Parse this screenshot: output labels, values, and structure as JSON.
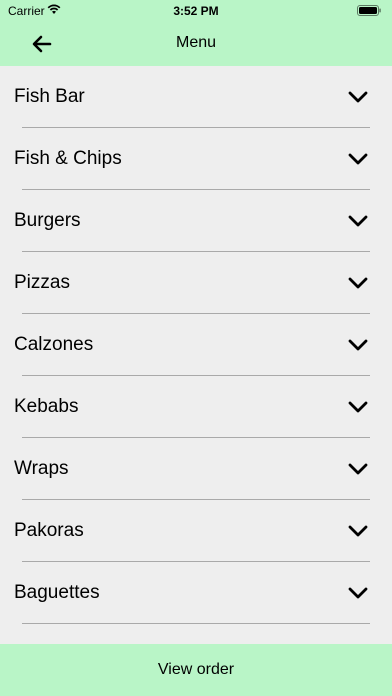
{
  "status_bar": {
    "carrier": "Carrier",
    "time": "3:52 PM",
    "wifi_icon": "wifi-icon",
    "battery_icon": "battery-icon"
  },
  "nav": {
    "title": "Menu",
    "back_icon": "arrow-left-icon"
  },
  "menu": {
    "items": [
      {
        "label": "Fish Bar"
      },
      {
        "label": "Fish & Chips"
      },
      {
        "label": "Burgers"
      },
      {
        "label": "Pizzas"
      },
      {
        "label": "Calzones"
      },
      {
        "label": "Kebabs"
      },
      {
        "label": "Wraps"
      },
      {
        "label": "Pakoras"
      },
      {
        "label": "Baguettes"
      }
    ],
    "chevron_icon": "chevron-down-icon"
  },
  "footer": {
    "button_label": "View order"
  },
  "colors": {
    "header_bg": "#b9f5c7",
    "list_bg": "#eeeeee",
    "divider": "#a9a9a9"
  }
}
